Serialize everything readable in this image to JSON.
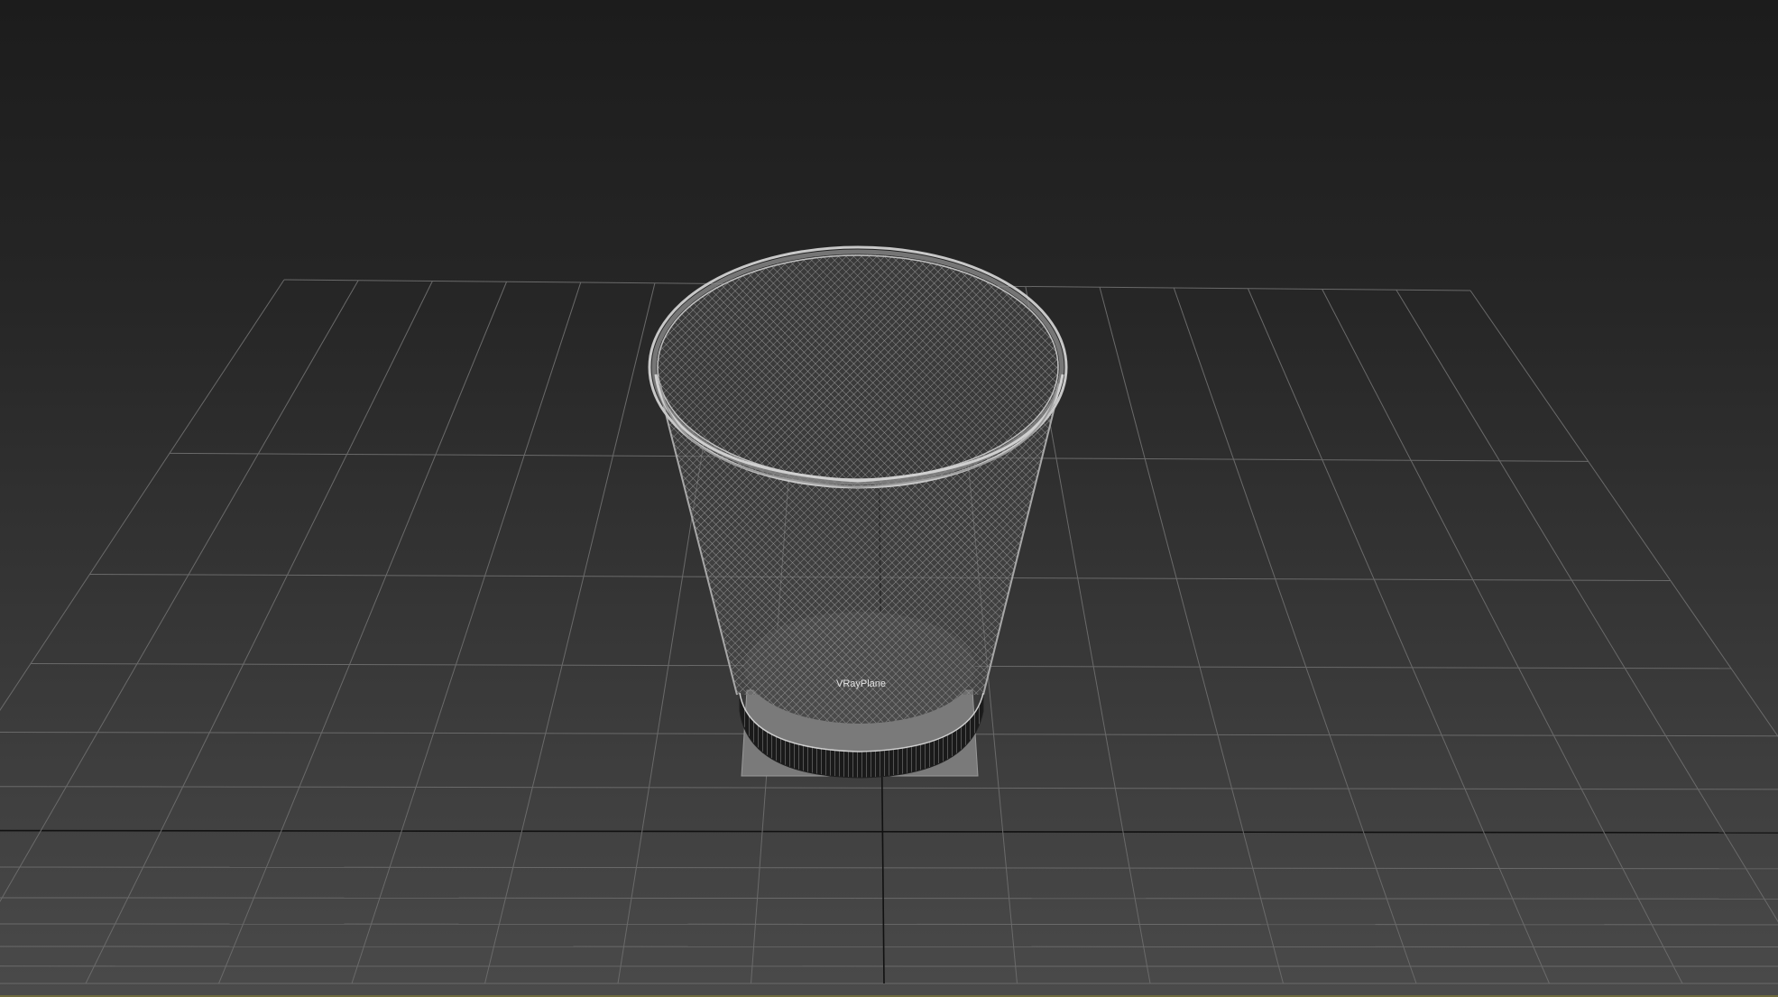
{
  "viewport": {
    "object_label": "VRayPlane"
  },
  "colors": {
    "background_top": "#1c1c1c",
    "background_bottom": "#4a4a4a",
    "grid_line": "#6a6a6a",
    "grid_axis": "#111111",
    "wireframe": "#8a8a8a",
    "plane_fill": "#7a7a7a",
    "bottom_ring": "#1a1a1a"
  }
}
